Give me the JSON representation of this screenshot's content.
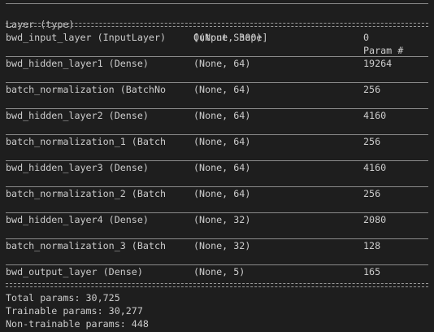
{
  "header": {
    "layer": "Layer (type)",
    "shape": "Output Shape",
    "params": "Param #"
  },
  "rows": [
    {
      "layer": "bwd_input_layer (InputLayer)",
      "shape": "[(None, 300)]",
      "params": "0"
    },
    {
      "layer": "bwd_hidden_layer1 (Dense)",
      "shape": "(None, 64)",
      "params": "19264"
    },
    {
      "layer": "batch_normalization (BatchNo",
      "shape": "(None, 64)",
      "params": "256"
    },
    {
      "layer": "bwd_hidden_layer2 (Dense)",
      "shape": "(None, 64)",
      "params": "4160"
    },
    {
      "layer": "batch_normalization_1 (Batch",
      "shape": "(None, 64)",
      "params": "256"
    },
    {
      "layer": "bwd_hidden_layer3 (Dense)",
      "shape": "(None, 64)",
      "params": "4160"
    },
    {
      "layer": "batch_normalization_2 (Batch",
      "shape": "(None, 64)",
      "params": "256"
    },
    {
      "layer": "bwd_hidden_layer4 (Dense)",
      "shape": "(None, 32)",
      "params": "2080"
    },
    {
      "layer": "batch_normalization_3 (Batch",
      "shape": "(None, 32)",
      "params": "128"
    },
    {
      "layer": "bwd_output_layer (Dense)",
      "shape": "(None, 5)",
      "params": "165"
    }
  ],
  "totals": {
    "total": "Total params: 30,725",
    "trainable": "Trainable params: 30,277",
    "non_trainable": "Non-trainable params: 448"
  }
}
